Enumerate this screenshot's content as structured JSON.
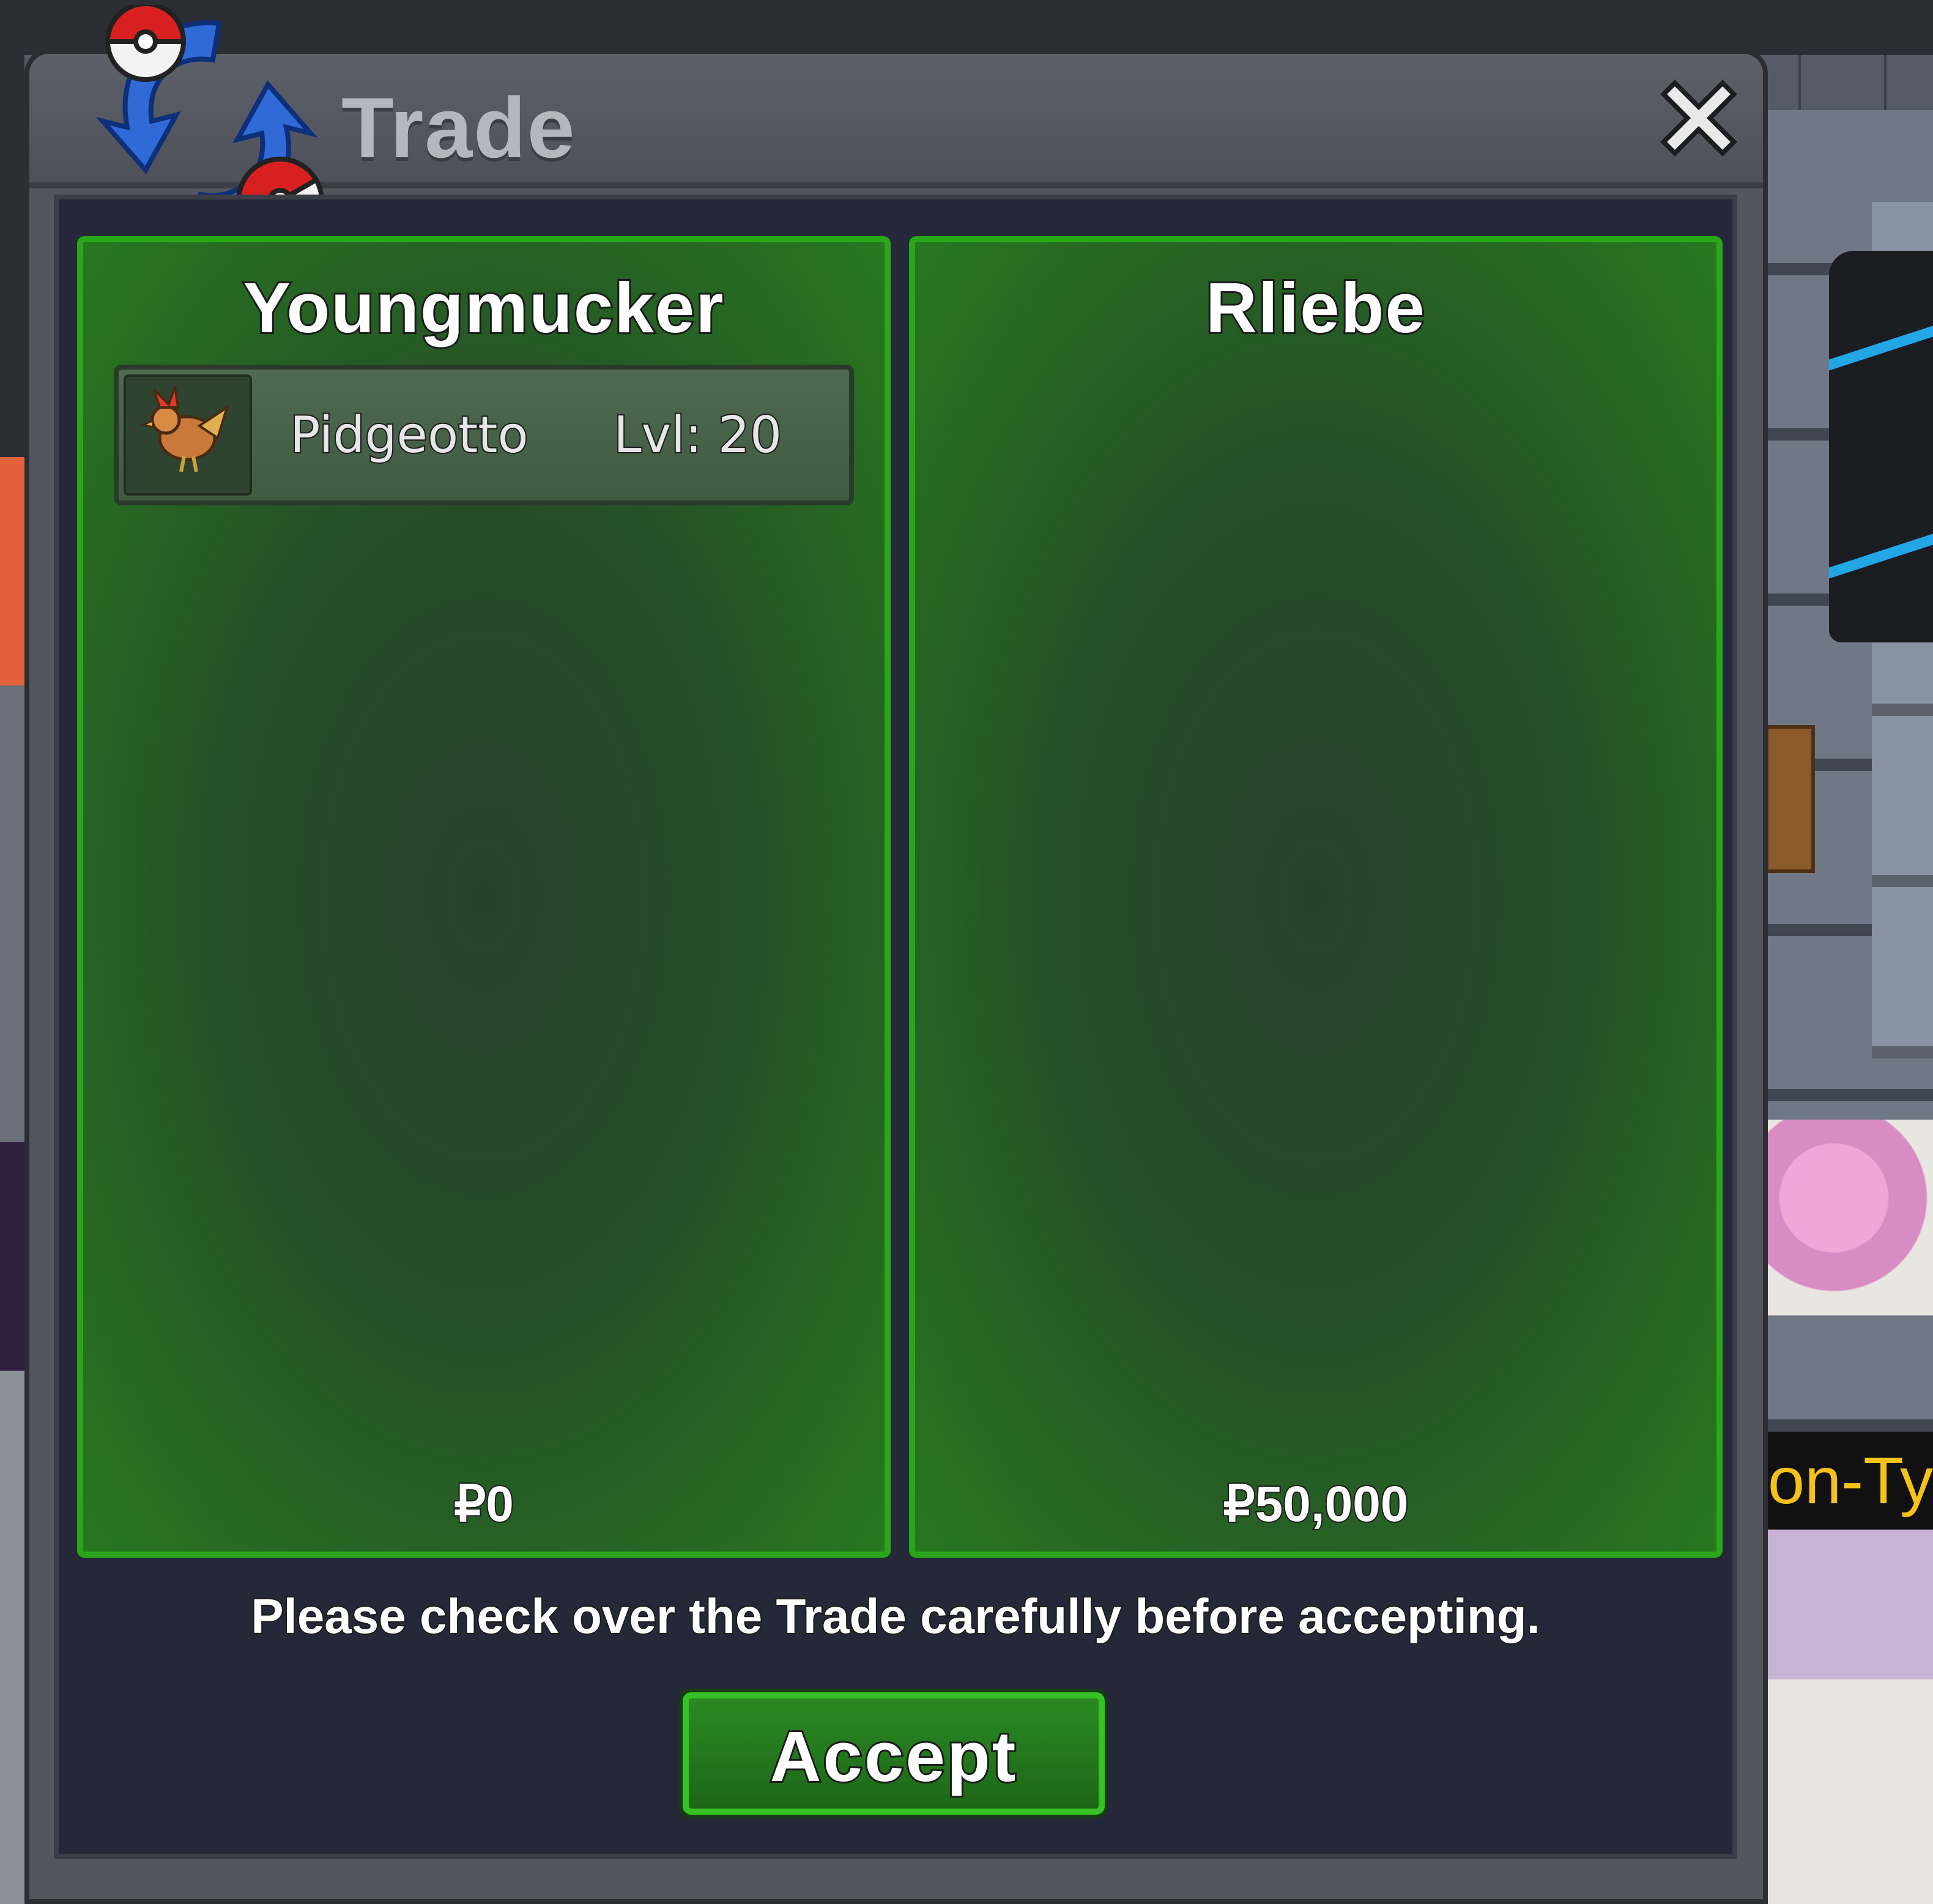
{
  "window": {
    "title": "Trade",
    "close_icon": "close-icon",
    "logo_icon": "trade-exchange-icon"
  },
  "left_panel": {
    "player_name": "Youngmucker",
    "offers": [
      {
        "pokemon": "Pidgeotto",
        "level": "Lvl: 20",
        "icon": "pidgeotto-sprite-icon"
      }
    ],
    "money": "₽0"
  },
  "right_panel": {
    "player_name": "Rliebe",
    "offers": [],
    "money": "₽50,000"
  },
  "notice": "Please check over the Trade carefully before accepting.",
  "accept_button": "Accept",
  "background": {
    "nameplate_fragment": "on-Ty"
  },
  "colors": {
    "panel_border": "#28a818",
    "panel_fill": "#264e28",
    "accept_fill": "#2a8a22",
    "window_bg": "#53565f",
    "inner_bg": "#252838"
  }
}
